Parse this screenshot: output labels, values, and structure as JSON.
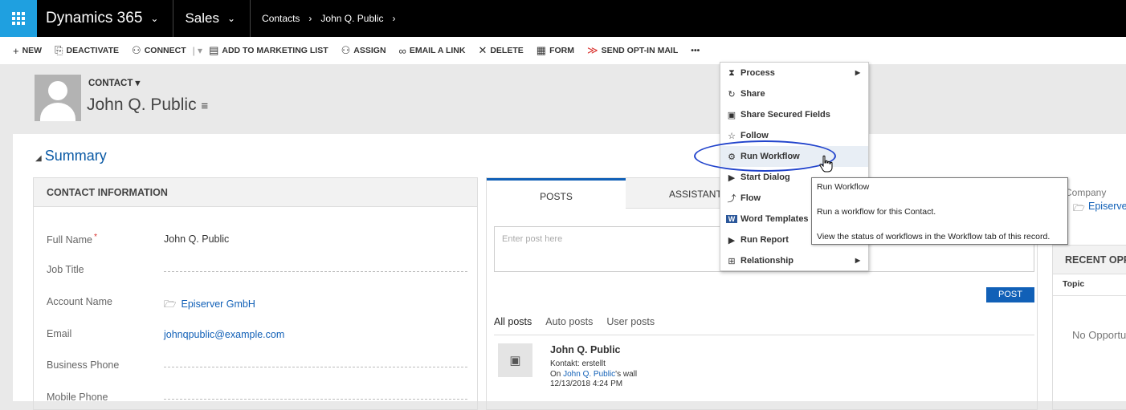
{
  "topnav": {
    "app_name": "Dynamics 365",
    "area": "Sales",
    "breadcrumb": [
      "Contacts",
      "John Q. Public"
    ],
    "caret": "⌄",
    "crumb_arrow": "›"
  },
  "commands": [
    {
      "icon": "plus-icon",
      "glyph": "+",
      "label": "NEW"
    },
    {
      "icon": "deactivate-icon",
      "glyph": "⎘",
      "label": "DEACTIVATE"
    },
    {
      "icon": "connect-icon",
      "glyph": "⚇",
      "label": "CONNECT"
    },
    {
      "icon": "marketing-list-icon",
      "glyph": "▤",
      "label": "ADD TO MARKETING LIST"
    },
    {
      "icon": "assign-icon",
      "glyph": "⚇",
      "label": "ASSIGN"
    },
    {
      "icon": "link-icon",
      "glyph": "∞",
      "label": "EMAIL A LINK"
    },
    {
      "icon": "delete-icon",
      "glyph": "✕",
      "label": "DELETE"
    },
    {
      "icon": "form-icon",
      "glyph": "▦",
      "label": "FORM"
    },
    {
      "icon": "opt-in-icon",
      "glyph": "≫",
      "label": "SEND OPT-IN MAIL"
    }
  ],
  "more_glyph": "•••",
  "header": {
    "entity_type": "CONTACT ▾",
    "record_name": "John Q. Public",
    "list_icon": "≡"
  },
  "summary": {
    "title": "Summary",
    "toggle": "◢"
  },
  "contact_info": {
    "heading": "CONTACT INFORMATION",
    "fields": [
      {
        "label": "Full Name",
        "value": "John Q. Public",
        "required": "*"
      },
      {
        "label": "Job Title",
        "value": ""
      },
      {
        "label": "Account Name",
        "value": "Episerver GmbH"
      },
      {
        "label": "Email",
        "value": "johnqpublic@example.com"
      },
      {
        "label": "Business Phone",
        "value": ""
      },
      {
        "label": "Mobile Phone",
        "value": ""
      }
    ]
  },
  "posts": {
    "tab_posts": "POSTS",
    "tab_assistant": "ASSISTANT",
    "placeholder": "Enter post here",
    "post_button": "POST",
    "filters": [
      "All posts",
      "Auto posts",
      "User posts"
    ],
    "entry": {
      "author": "John Q. Public",
      "line1": "Kontakt: erstellt",
      "line2_prefix": "On ",
      "line2_link": "John Q. Public",
      "line2_suffix": "'s wall",
      "timestamp": "12/13/2018 4:24 PM"
    }
  },
  "right": {
    "company_label": "Company",
    "company_value": "Episerver",
    "recent_heading": "RECENT OPPORTUNITIES",
    "topic_col": "Topic",
    "empty_text": "No Opportunities"
  },
  "menu": {
    "items": [
      {
        "icon": "process-icon",
        "glyph": "⧗",
        "label": "Process",
        "submenu": true
      },
      {
        "icon": "share-icon",
        "glyph": "↻",
        "label": "Share"
      },
      {
        "icon": "secured-fields-icon",
        "glyph": "▣",
        "label": "Share Secured Fields"
      },
      {
        "icon": "star-icon",
        "glyph": "☆",
        "label": "Follow"
      },
      {
        "icon": "workflow-icon",
        "glyph": "⚙",
        "label": "Run Workflow",
        "highlighted": true
      },
      {
        "icon": "dialog-icon",
        "glyph": "▶",
        "label": "Start Dialog"
      },
      {
        "icon": "flow-icon",
        "glyph": "⤴",
        "label": "Flow"
      },
      {
        "icon": "word-icon",
        "glyph": "W",
        "label": "Word Templates"
      },
      {
        "icon": "report-icon",
        "glyph": "▶",
        "label": "Run Report"
      },
      {
        "icon": "relationship-icon",
        "glyph": "⊞",
        "label": "Relationship",
        "submenu": true
      }
    ],
    "submenu_arrow": "▶"
  },
  "tooltip": {
    "title": "Run Workflow",
    "description": "Run a workflow for this Contact.",
    "hint": "View the status of workflows in the Workflow tab of this record."
  },
  "colors": {
    "accent": "#1160b7",
    "waffle": "#1fa0e0",
    "highlight_ellipse": "#2244cc"
  }
}
